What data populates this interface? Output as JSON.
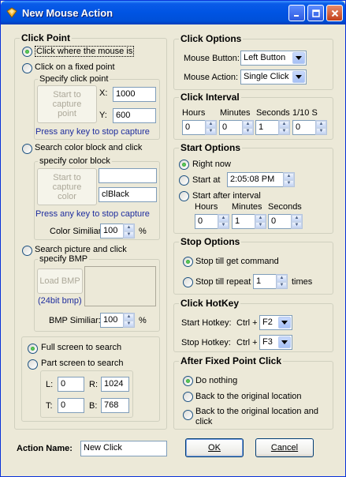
{
  "window": {
    "title": "New Mouse Action"
  },
  "click_point": {
    "title": "Click Point",
    "opt_mouse": "Click where the mouse is",
    "opt_fixed": "Click on a fixed point",
    "specify_title": "Specify click point",
    "capture_btn": "Start to capture point",
    "x_label": "X:",
    "x_value": "1000",
    "y_label": "Y:",
    "y_value": "600",
    "press_key": "Press any key to stop capture",
    "opt_color": "Search color block and click",
    "color_title": "specify color block",
    "capture_color_btn": "Start to capture color",
    "color_value": "",
    "color_name": "clBlack",
    "press_key2": "Press any key to stop capture",
    "color_similar_label": "Color Similiar:",
    "color_similar_value": "100",
    "color_similar_unit": "%",
    "opt_picture": "Search picture and click",
    "bmp_title": "specify BMP",
    "load_bmp_btn": "Load BMP",
    "bmp_note": "(24bit bmp)",
    "bmp_similar_label": "BMP Similiar:",
    "bmp_similar_value": "100",
    "bmp_similar_unit": "%",
    "full_screen": "Full screen to search",
    "part_screen": "Part screen to search",
    "l_label": "L:",
    "l_value": "0",
    "r_label": "R:",
    "r_value": "1024",
    "t_label": "T:",
    "t_value": "0",
    "b_label": "B:",
    "b_value": "768"
  },
  "click_options": {
    "title": "Click Options",
    "mouse_button_label": "Mouse Button:",
    "mouse_button_value": "Left Button",
    "mouse_action_label": "Mouse Action:",
    "mouse_action_value": "Single Click"
  },
  "click_interval": {
    "title": "Click Interval",
    "hours": "Hours",
    "minutes": "Minutes",
    "seconds": "Seconds",
    "tenths": "1/10 S",
    "hours_value": "0",
    "minutes_value": "0",
    "seconds_value": "1",
    "tenths_value": "0"
  },
  "start_options": {
    "title": "Start Options",
    "right_now": "Right now",
    "start_at": "Start at",
    "start_at_value": "2:05:08 PM",
    "after_interval": "Start after interval",
    "hours": "Hours",
    "minutes": "Minutes",
    "seconds": "Seconds",
    "hours_value": "0",
    "minutes_value": "1",
    "seconds_value": "0"
  },
  "stop_options": {
    "title": "Stop Options",
    "till_command": "Stop till get command",
    "till_repeat": "Stop till repeat",
    "repeat_value": "1",
    "times": "times"
  },
  "hotkey": {
    "title": "Click HotKey",
    "start_label": "Start Hotkey:",
    "start_ctrl": "Ctrl +",
    "start_key": "F2",
    "stop_label": "Stop Hotkey:",
    "stop_ctrl": "Ctrl +",
    "stop_key": "F3"
  },
  "after_fixed": {
    "title": "After Fixed Point Click",
    "do_nothing": "Do nothing",
    "back_original": "Back to the original location",
    "back_original_click": "Back to the original location and click"
  },
  "footer": {
    "action_name_label": "Action Name:",
    "action_name_value": "New Click",
    "ok": "OK",
    "cancel": "Cancel"
  },
  "colors": {
    "title_blue": "#0054E3",
    "face": "#ECE9D8",
    "link_blue": "#1E2D9E"
  }
}
